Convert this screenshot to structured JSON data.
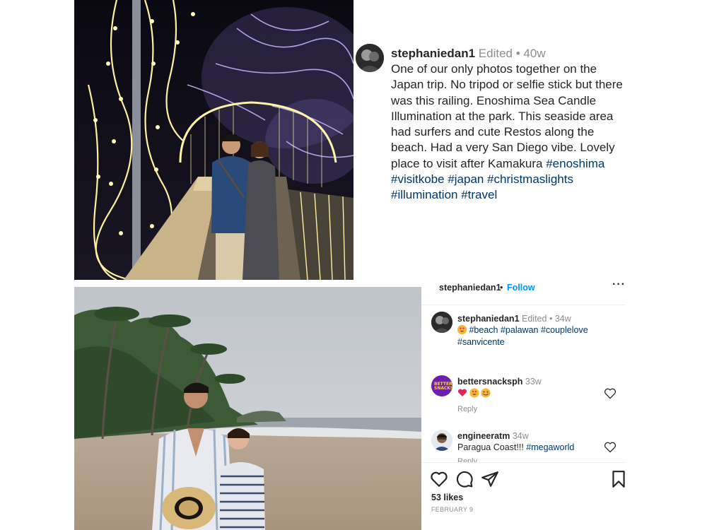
{
  "post1": {
    "username": "stephaniedan1",
    "edited": "Edited",
    "separator": "•",
    "age": "40w",
    "caption": "One of our only photos together on the Japan trip. No tripod or selfie stick but there was this railing. Enoshima Sea Candle Illumination at the park. This seaside area had surfers and cute Restos along the beach. Had a very San Diego vibe. Lovely place to visit after Kamakura",
    "hashtags": "#enoshima #visitkobe #japan #christmaslights #illumination #travel"
  },
  "post2": {
    "header": {
      "username": "stephaniedan1",
      "separator": "•",
      "follow": "Follow",
      "more": "···"
    },
    "caption": {
      "username": "stephaniedan1",
      "edited": "Edited",
      "separator": "•",
      "age": "34w",
      "hashtags": "#beach #palawan #couplelove #sanvicente"
    },
    "comments": [
      {
        "username": "bettersnacksph",
        "age": "33w",
        "text": "",
        "reply": "Reply",
        "avatar_text": "BETTER SNACKS"
      },
      {
        "username": "engineeratm",
        "age": "34w",
        "text": "Paragua Coast!!! ",
        "hashtag": "#megaworld",
        "reply": "Reply"
      }
    ],
    "likes": "53 likes",
    "date": "FEBRUARY 9"
  },
  "icons": [
    "heart-icon",
    "comment-icon",
    "share-icon",
    "bookmark-icon",
    "more-icon",
    "heart-emoji",
    "heart-eyes-emoji",
    "smiling-emoji"
  ],
  "colors": {
    "link_blue": "#0095f6",
    "hashtag_blue": "#00376b",
    "meta_gray": "#8e8e8e",
    "text": "#262626",
    "heart_red": "#ed4956"
  }
}
